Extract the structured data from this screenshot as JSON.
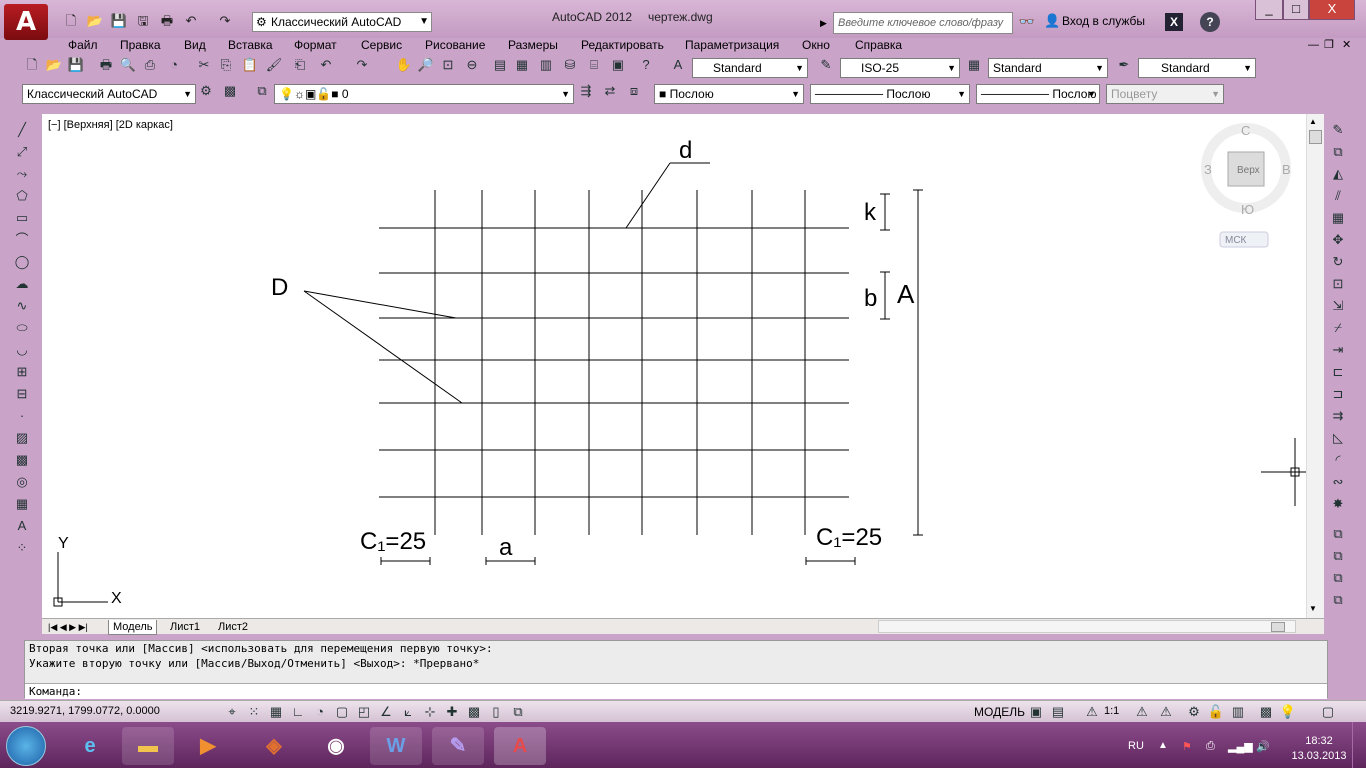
{
  "window": {
    "app_title": "AutoCAD 2012",
    "file_title": "чертеж.dwg",
    "min": "_",
    "max": "□",
    "close": "X"
  },
  "quickaccess": {
    "workspace": "Классический AutoCAD"
  },
  "search": {
    "placeholder": "Введите ключевое слово/фразу"
  },
  "signin": "Вход в службы",
  "help": "?",
  "menu": [
    "Файл",
    "Правка",
    "Вид",
    "Вставка",
    "Формат",
    "Сервис",
    "Рисование",
    "Размеры",
    "Редактировать",
    "Параметризация",
    "Окно",
    "Справка"
  ],
  "styles": {
    "text_style": "Standard",
    "dim_style": "ISO-25",
    "table_style": "Standard",
    "mleader_style": "Standard"
  },
  "layers": {
    "workspace": "Классический AutoCAD",
    "layer": "0",
    "color": "Послою",
    "linetype": "Послою",
    "lineweight": "Послою",
    "plotstyle": "Поцвету"
  },
  "viewport": {
    "label": "[−] [Верхняя] [2D каркас]"
  },
  "viewcube": {
    "north": "С",
    "south": "Ю",
    "west": "З",
    "east": "В",
    "face": "Верх",
    "ucs": "МСК"
  },
  "drawing": {
    "label_d": "d",
    "label_k": "k",
    "label_b": "b",
    "label_A": "A",
    "label_D": "D",
    "label_a": "a",
    "label_c_left": "C₁=25",
    "label_c_right": "C₁=25",
    "axis_x": "X",
    "axis_y": "Y"
  },
  "tabs": [
    "Модель",
    "Лист1",
    "Лист2"
  ],
  "command": {
    "line1": "Вторая точка или [Массив] <использовать для перемещения первую точку>:",
    "line2": "Укажите вторую точку или [Массив/Выход/Отменить] <Выход>: *Прервано*",
    "prompt": "Команда:"
  },
  "status": {
    "coords": "3219.9271, 1799.0772, 0.0000",
    "model": "МОДЕЛЬ",
    "scale": "1:1"
  },
  "taskbar": {
    "lang": "RU",
    "time": "18:32",
    "date": "13.03.2013"
  }
}
